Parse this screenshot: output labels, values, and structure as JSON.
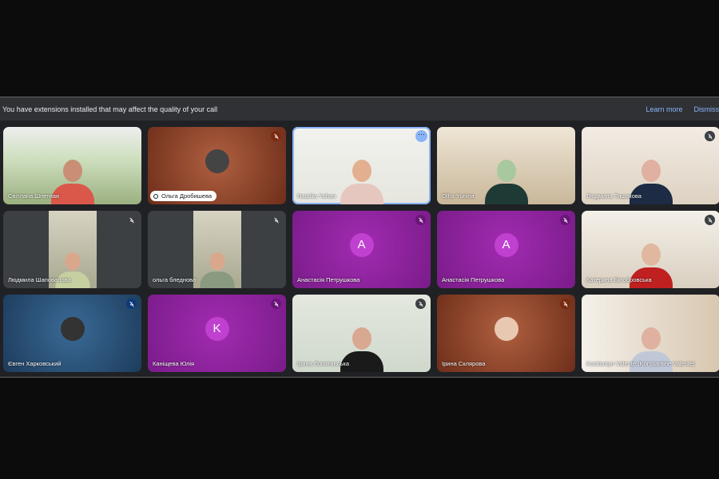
{
  "banner": {
    "message": "You have extensions installed that may affect the quality of your call",
    "learn_more": "Learn more",
    "dismiss": "Dismiss"
  },
  "participants": [
    {
      "name": "Світлана Шпетная",
      "muted": false
    },
    {
      "name": "Ольга Дробишева",
      "muted": true,
      "pinned": true
    },
    {
      "name": "Nataliia Yuhan",
      "muted": false,
      "speaking": true
    },
    {
      "name": "Olha Yunina",
      "muted": false
    },
    {
      "name": "Людмила Тишакова",
      "muted": true
    },
    {
      "name": "Людмила Шаповалова",
      "muted": true
    },
    {
      "name": "ольга бледнова",
      "muted": true
    },
    {
      "name": "Анастасія Петрушкова",
      "muted": true,
      "initial": "A"
    },
    {
      "name": "Анастасія Петрушкова",
      "muted": true,
      "initial": "A"
    },
    {
      "name": "Катерина Білобровська",
      "muted": true
    },
    {
      "name": "Євген Харковський",
      "muted": true
    },
    {
      "name": "Каніщева Юлія",
      "muted": true,
      "initial": "K"
    },
    {
      "name": "Ірина Лопатинська",
      "muted": true
    },
    {
      "name": "Ірина Склярова",
      "muted": true
    },
    {
      "name": "Kostiantyn Valente (Konstantine Valente)",
      "muted": false
    }
  ],
  "colors": {
    "accent": "#8ab4f8",
    "avatar_purple": "#a12bb0"
  }
}
